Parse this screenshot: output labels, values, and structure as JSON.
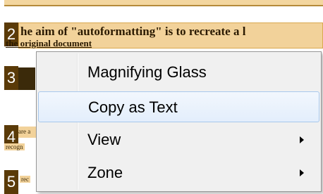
{
  "document": {
    "zones": [
      {
        "number": "2",
        "text_line1": "he aim of \"autoformatting\" is to recreate a l",
        "text_line2": "the original document"
      },
      {
        "number": "3"
      },
      {
        "number": "4",
        "small_text": "are a",
        "small_text2": "recogn"
      },
      {
        "number": "5",
        "small_text": "rec"
      }
    ]
  },
  "context_menu": {
    "items": [
      {
        "label": "Magnifying Glass",
        "has_submenu": false,
        "highlighted": false
      },
      {
        "label": "Copy as Text",
        "has_submenu": false,
        "highlighted": true
      },
      {
        "label": "View",
        "has_submenu": true,
        "highlighted": false
      },
      {
        "label": "Zone",
        "has_submenu": true,
        "highlighted": false
      }
    ]
  }
}
